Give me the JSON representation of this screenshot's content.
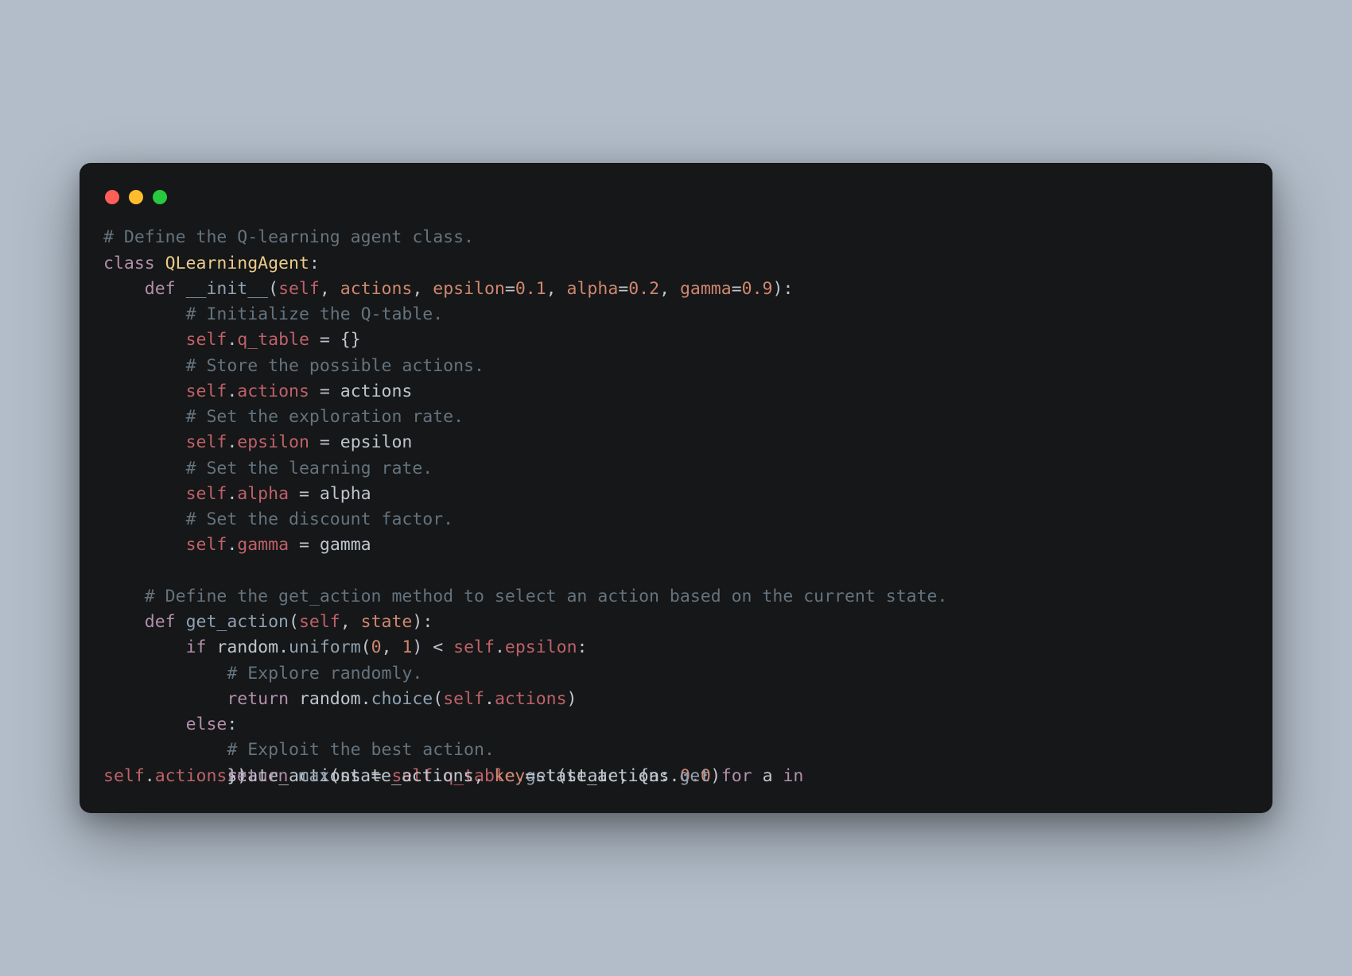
{
  "code": {
    "lines": [
      {
        "indent": 0,
        "tokens": [
          {
            "t": "# Define the Q-learning agent class.",
            "c": "c-comment"
          }
        ]
      },
      {
        "indent": 0,
        "tokens": [
          {
            "t": "class ",
            "c": "c-keyword"
          },
          {
            "t": "QLearningAgent",
            "c": "c-class"
          },
          {
            "t": ":",
            "c": "c-op"
          }
        ]
      },
      {
        "indent": 1,
        "tokens": [
          {
            "t": "def ",
            "c": "c-keyword"
          },
          {
            "t": "__init__",
            "c": "c-func"
          },
          {
            "t": "(",
            "c": "c-op"
          },
          {
            "t": "self",
            "c": "c-self"
          },
          {
            "t": ", ",
            "c": "c-op"
          },
          {
            "t": "actions",
            "c": "c-param"
          },
          {
            "t": ", ",
            "c": "c-op"
          },
          {
            "t": "epsilon",
            "c": "c-param"
          },
          {
            "t": "=",
            "c": "c-op"
          },
          {
            "t": "0.1",
            "c": "c-num"
          },
          {
            "t": ", ",
            "c": "c-op"
          },
          {
            "t": "alpha",
            "c": "c-param"
          },
          {
            "t": "=",
            "c": "c-op"
          },
          {
            "t": "0.2",
            "c": "c-num"
          },
          {
            "t": ", ",
            "c": "c-op"
          },
          {
            "t": "gamma",
            "c": "c-param"
          },
          {
            "t": "=",
            "c": "c-op"
          },
          {
            "t": "0.9",
            "c": "c-num"
          },
          {
            "t": "):",
            "c": "c-op"
          }
        ]
      },
      {
        "indent": 2,
        "tokens": [
          {
            "t": "# Initialize the Q-table.",
            "c": "c-comment"
          }
        ]
      },
      {
        "indent": 2,
        "tokens": [
          {
            "t": "self",
            "c": "c-self"
          },
          {
            "t": ".",
            "c": "c-op"
          },
          {
            "t": "q_table",
            "c": "c-attr"
          },
          {
            "t": " = {}",
            "c": "c-op"
          }
        ]
      },
      {
        "indent": 2,
        "tokens": [
          {
            "t": "# Store the possible actions.",
            "c": "c-comment"
          }
        ]
      },
      {
        "indent": 2,
        "tokens": [
          {
            "t": "self",
            "c": "c-self"
          },
          {
            "t": ".",
            "c": "c-op"
          },
          {
            "t": "actions",
            "c": "c-attr"
          },
          {
            "t": " = ",
            "c": "c-op"
          },
          {
            "t": "actions",
            "c": "c-ident"
          }
        ]
      },
      {
        "indent": 2,
        "tokens": [
          {
            "t": "# Set the exploration rate.",
            "c": "c-comment"
          }
        ]
      },
      {
        "indent": 2,
        "tokens": [
          {
            "t": "self",
            "c": "c-self"
          },
          {
            "t": ".",
            "c": "c-op"
          },
          {
            "t": "epsilon",
            "c": "c-attr"
          },
          {
            "t": " = ",
            "c": "c-op"
          },
          {
            "t": "epsilon",
            "c": "c-ident"
          }
        ]
      },
      {
        "indent": 2,
        "tokens": [
          {
            "t": "# Set the learning rate.",
            "c": "c-comment"
          }
        ]
      },
      {
        "indent": 2,
        "tokens": [
          {
            "t": "self",
            "c": "c-self"
          },
          {
            "t": ".",
            "c": "c-op"
          },
          {
            "t": "alpha",
            "c": "c-attr"
          },
          {
            "t": " = ",
            "c": "c-op"
          },
          {
            "t": "alpha",
            "c": "c-ident"
          }
        ]
      },
      {
        "indent": 2,
        "tokens": [
          {
            "t": "# Set the discount factor.",
            "c": "c-comment"
          }
        ]
      },
      {
        "indent": 2,
        "tokens": [
          {
            "t": "self",
            "c": "c-self"
          },
          {
            "t": ".",
            "c": "c-op"
          },
          {
            "t": "gamma",
            "c": "c-attr"
          },
          {
            "t": " = ",
            "c": "c-op"
          },
          {
            "t": "gamma",
            "c": "c-ident"
          }
        ]
      },
      {
        "indent": 0,
        "tokens": [
          {
            "t": " ",
            "c": "c-op"
          }
        ]
      },
      {
        "indent": 1,
        "tokens": [
          {
            "t": "# Define the get_action method to select an action based on the current state.",
            "c": "c-comment"
          }
        ]
      },
      {
        "indent": 1,
        "tokens": [
          {
            "t": "def ",
            "c": "c-keyword"
          },
          {
            "t": "get_action",
            "c": "c-func"
          },
          {
            "t": "(",
            "c": "c-op"
          },
          {
            "t": "self",
            "c": "c-self"
          },
          {
            "t": ", ",
            "c": "c-op"
          },
          {
            "t": "state",
            "c": "c-param"
          },
          {
            "t": "):",
            "c": "c-op"
          }
        ]
      },
      {
        "indent": 2,
        "tokens": [
          {
            "t": "if ",
            "c": "c-keyword"
          },
          {
            "t": "random",
            "c": "c-ident"
          },
          {
            "t": ".",
            "c": "c-op"
          },
          {
            "t": "uniform",
            "c": "c-call"
          },
          {
            "t": "(",
            "c": "c-op"
          },
          {
            "t": "0",
            "c": "c-num"
          },
          {
            "t": ", ",
            "c": "c-op"
          },
          {
            "t": "1",
            "c": "c-num"
          },
          {
            "t": ") < ",
            "c": "c-op"
          },
          {
            "t": "self",
            "c": "c-self"
          },
          {
            "t": ".",
            "c": "c-op"
          },
          {
            "t": "epsilon",
            "c": "c-attr"
          },
          {
            "t": ":",
            "c": "c-op"
          }
        ]
      },
      {
        "indent": 3,
        "tokens": [
          {
            "t": "# Explore randomly.",
            "c": "c-comment"
          }
        ]
      },
      {
        "indent": 3,
        "tokens": [
          {
            "t": "return ",
            "c": "c-keyword"
          },
          {
            "t": "random",
            "c": "c-ident"
          },
          {
            "t": ".",
            "c": "c-op"
          },
          {
            "t": "choice",
            "c": "c-call"
          },
          {
            "t": "(",
            "c": "c-op"
          },
          {
            "t": "self",
            "c": "c-self"
          },
          {
            "t": ".",
            "c": "c-op"
          },
          {
            "t": "actions",
            "c": "c-attr"
          },
          {
            "t": ")",
            "c": "c-op"
          }
        ]
      },
      {
        "indent": 2,
        "tokens": [
          {
            "t": "else",
            "c": "c-keyword"
          },
          {
            "t": ":",
            "c": "c-op"
          }
        ]
      },
      {
        "indent": 3,
        "tokens": [
          {
            "t": "# Exploit the best action.",
            "c": "c-comment"
          }
        ]
      },
      {
        "indent": 3,
        "tokens": [
          {
            "t": "state_actions",
            "c": "c-ident"
          },
          {
            "t": " = ",
            "c": "c-op"
          },
          {
            "t": "self",
            "c": "c-self"
          },
          {
            "t": ".",
            "c": "c-op"
          },
          {
            "t": "q_table",
            "c": "c-attr"
          },
          {
            "t": ".",
            "c": "c-op"
          },
          {
            "t": "get",
            "c": "c-call"
          },
          {
            "t": "(",
            "c": "c-op"
          },
          {
            "t": "state",
            "c": "c-ident"
          },
          {
            "t": ", {",
            "c": "c-op"
          },
          {
            "t": "a",
            "c": "c-ident"
          },
          {
            "t": ": ",
            "c": "c-op"
          },
          {
            "t": "0.0",
            "c": "c-num"
          },
          {
            "t": " for ",
            "c": "c-keyword"
          },
          {
            "t": "a",
            "c": "c-ident"
          },
          {
            "t": " in ",
            "c": "c-keyword"
          }
        ]
      },
      {
        "indent": 0,
        "tokens": [
          {
            "t": "self",
            "c": "c-self"
          },
          {
            "t": ".",
            "c": "c-op"
          },
          {
            "t": "actions",
            "c": "c-attr"
          },
          {
            "t": "})",
            "c": "c-op"
          },
          {
            "t": "return ",
            "c": "c-keyword"
          },
          {
            "t": "max",
            "c": "c-call"
          },
          {
            "t": "(",
            "c": "c-op"
          },
          {
            "t": "state_actions",
            "c": "c-ident"
          },
          {
            "t": ", ",
            "c": "c-op"
          },
          {
            "t": "key",
            "c": "c-param"
          },
          {
            "t": "=",
            "c": "c-op"
          },
          {
            "t": "state_actions",
            "c": "c-ident"
          },
          {
            "t": ".",
            "c": "c-op"
          },
          {
            "t": "get",
            "c": "c-prop"
          },
          {
            "t": ")",
            "c": "c-op"
          }
        ],
        "overlap": true
      }
    ],
    "indent_unit": "    "
  }
}
